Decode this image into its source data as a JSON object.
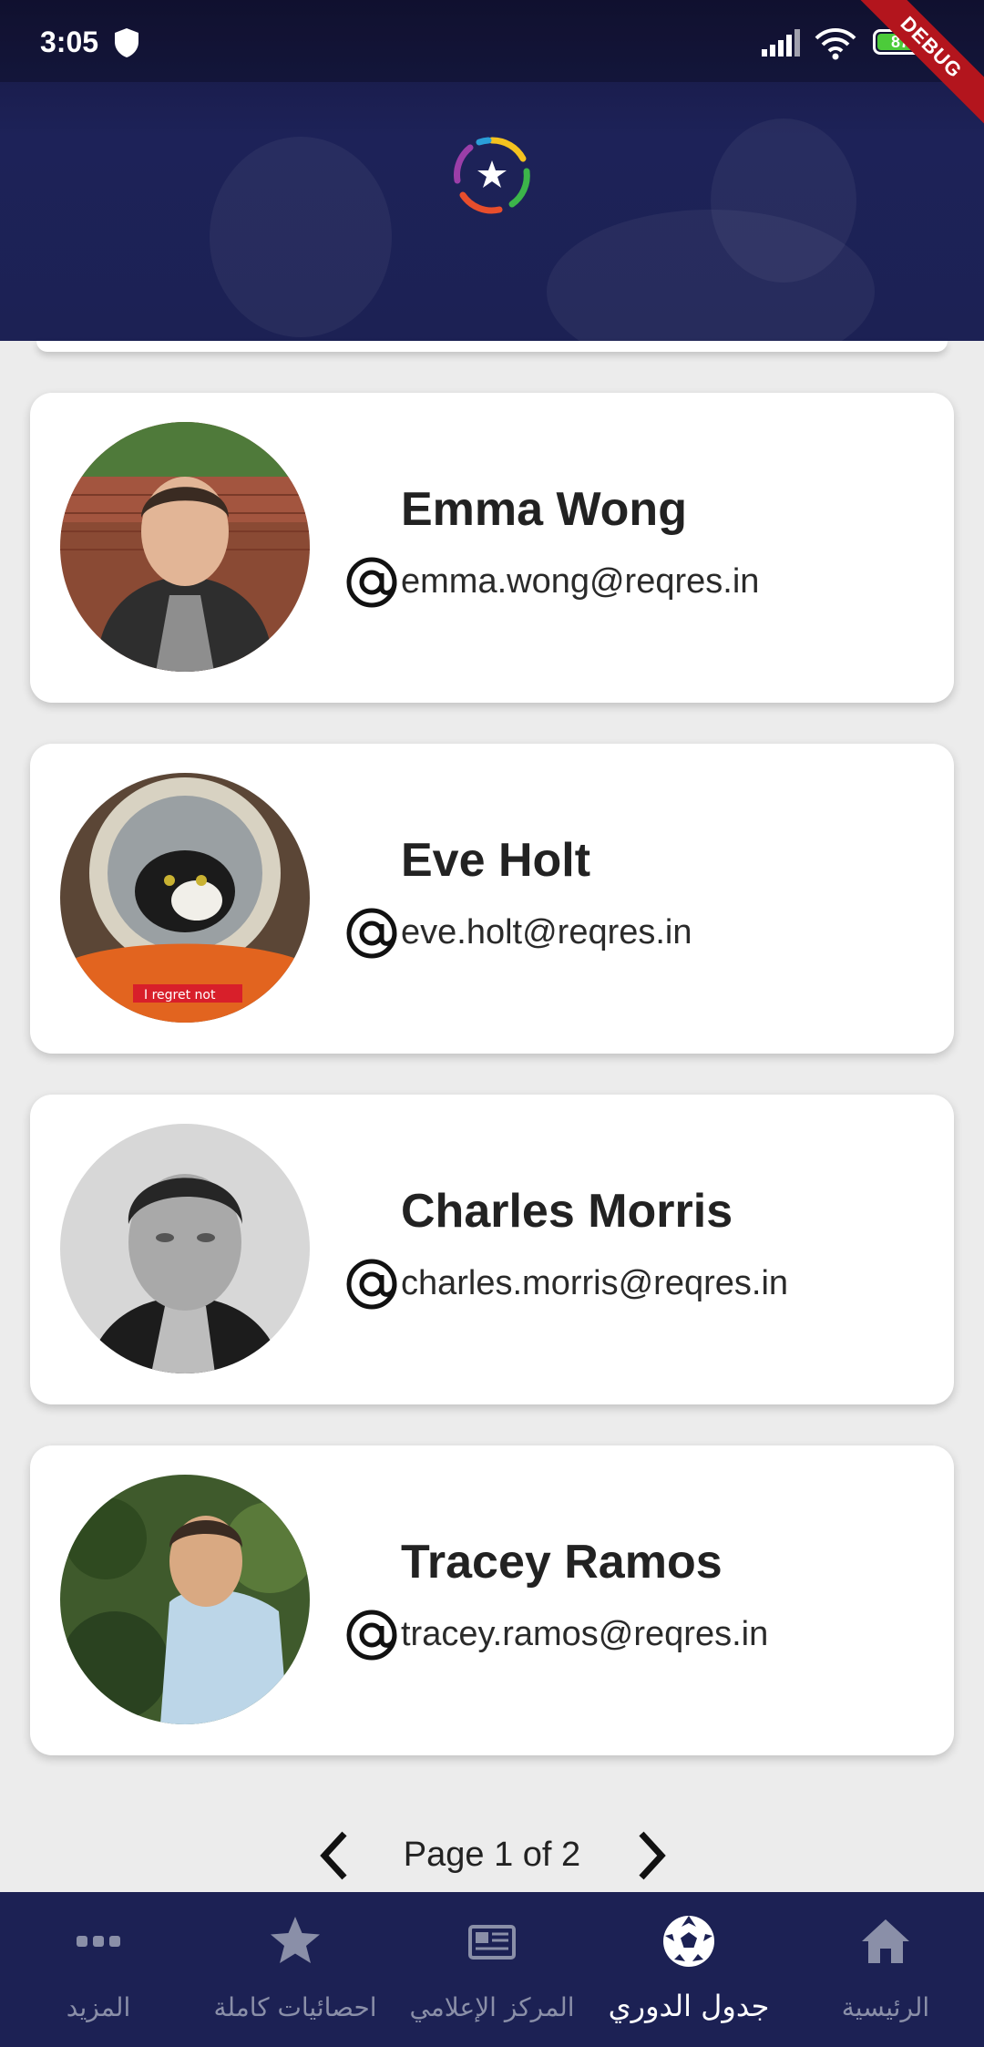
{
  "status_bar": {
    "time": "3:05",
    "battery": "87"
  },
  "debug_banner": "DEBUG",
  "users": [
    {
      "name": "Emma Wong",
      "email": "emma.wong@reqres.in"
    },
    {
      "name": "Eve Holt",
      "email": "eve.holt@reqres.in"
    },
    {
      "name": "Charles Morris",
      "email": "charles.morris@reqres.in"
    },
    {
      "name": "Tracey Ramos",
      "email": "tracey.ramos@reqres.in"
    }
  ],
  "pagination": {
    "text": "Page 1 of 2"
  },
  "bottom_nav": [
    {
      "label": "المزيد",
      "icon": "more-icon",
      "active": false
    },
    {
      "label": "احصائيات كاملة",
      "icon": "star-icon",
      "active": false
    },
    {
      "label": "المركز الإعلامي",
      "icon": "newspaper-icon",
      "active": false
    },
    {
      "label": "جدول الدوري",
      "icon": "soccer-ball-icon",
      "active": true
    },
    {
      "label": "الرئيسية",
      "icon": "home-icon",
      "active": false
    }
  ],
  "colors": {
    "header_bg": "#1c2154",
    "nav_bg": "#1c2154",
    "page_bg": "#ececec",
    "card_bg": "#ffffff",
    "battery_fill": "#4ccb3a",
    "debug_banner": "#b3151d"
  }
}
